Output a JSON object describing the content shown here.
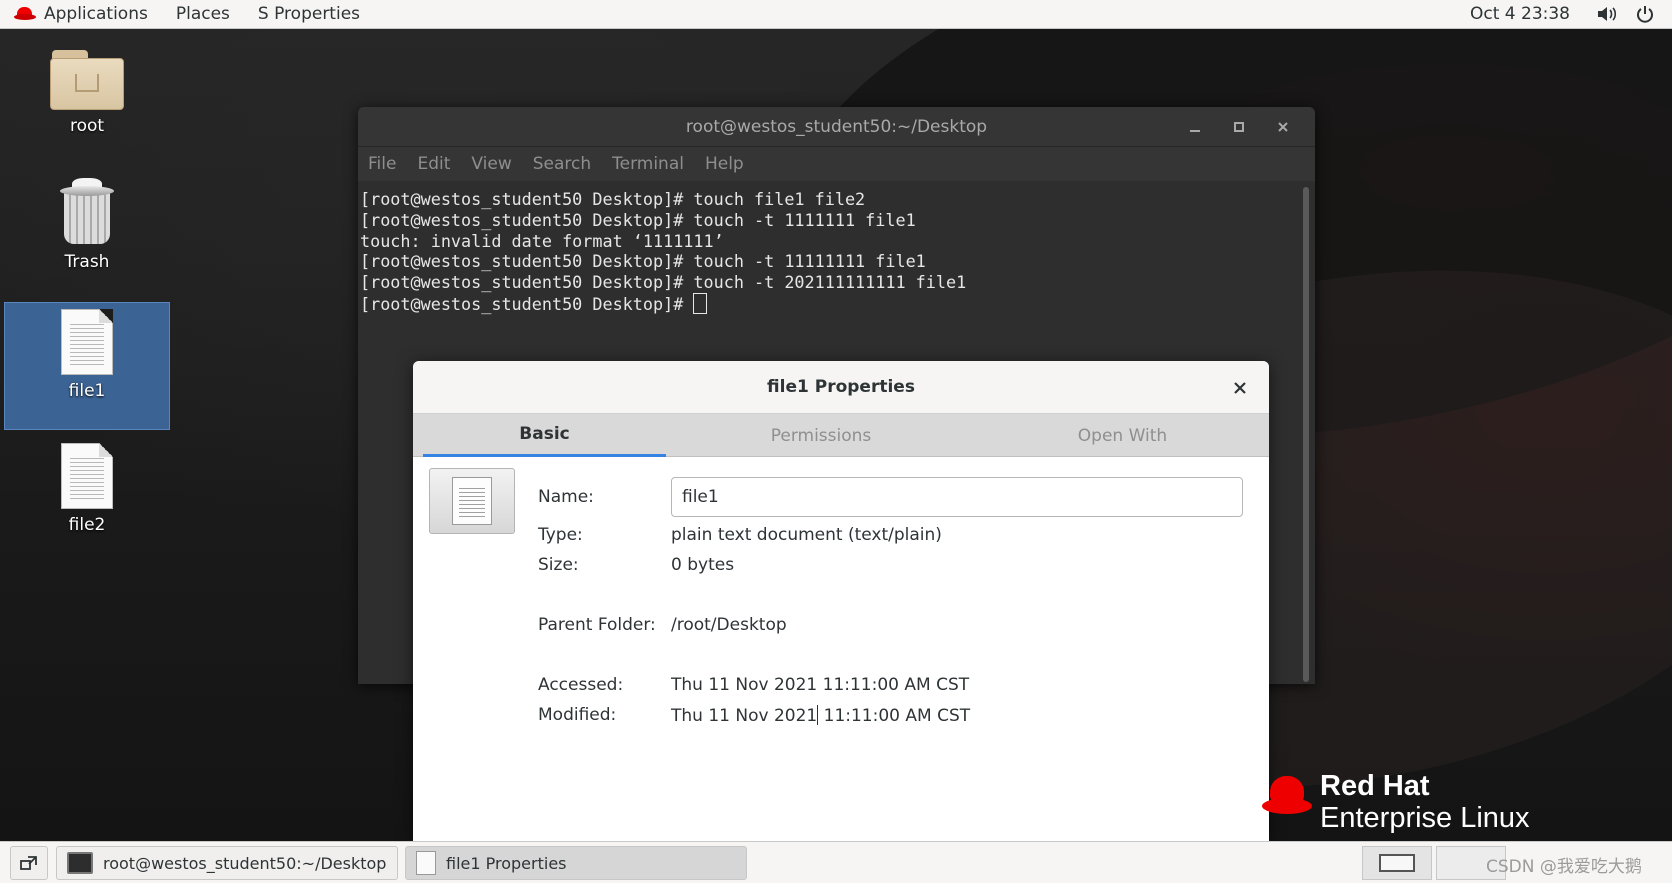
{
  "topbar": {
    "applications": "Applications",
    "places": "Places",
    "app_menu": "S Properties",
    "clock": "Oct 4  23:38",
    "volume_icon": "volume-icon",
    "power_icon": "power-icon"
  },
  "desktop": {
    "icons": [
      {
        "label": "root",
        "icon": "home-folder-icon"
      },
      {
        "label": "Trash",
        "icon": "trash-icon"
      },
      {
        "label": "file1",
        "icon": "text-file-icon",
        "selected": true
      },
      {
        "label": "file2",
        "icon": "text-file-icon"
      }
    ]
  },
  "terminal": {
    "title": "root@westos_student50:~/Desktop",
    "menu": [
      "File",
      "Edit",
      "View",
      "Search",
      "Terminal",
      "Help"
    ],
    "lines": [
      "[root@westos_student50 Desktop]# touch file1 file2",
      "[root@westos_student50 Desktop]# touch -t 1111111 file1",
      "touch: invalid date format ‘1111111’",
      "[root@westos_student50 Desktop]# touch -t 11111111 file1",
      "[root@westos_student50 Desktop]# touch -t 202111111111 file1",
      "[root@westos_student50 Desktop]# "
    ]
  },
  "properties": {
    "title": "file1 Properties",
    "tabs": [
      "Basic",
      "Permissions",
      "Open With"
    ],
    "active_tab": "Basic",
    "name_label": "Name:",
    "name_value": "file1",
    "type_label": "Type:",
    "type_value": "plain text document (text/plain)",
    "size_label": "Size:",
    "size_value": "0 bytes",
    "parent_label": "Parent Folder:",
    "parent_value": "/root/Desktop",
    "accessed_label": "Accessed:",
    "accessed_value": "Thu 11 Nov 2021 11:11:00 AM CST",
    "modified_label": "Modified:",
    "modified_value_a": "Thu 11 Nov 2021",
    "modified_value_b": " 11:11:00 AM CST"
  },
  "logo": {
    "line1": "Red Hat",
    "line2": "Enterprise Linux"
  },
  "taskbar": {
    "items": [
      {
        "label": "root@westos_student50:~/Desktop",
        "icon": "terminal-icon"
      },
      {
        "label": "file1 Properties",
        "icon": "document-icon",
        "active": true
      }
    ],
    "watermark": "CSDN @我爱吃大鹅"
  }
}
